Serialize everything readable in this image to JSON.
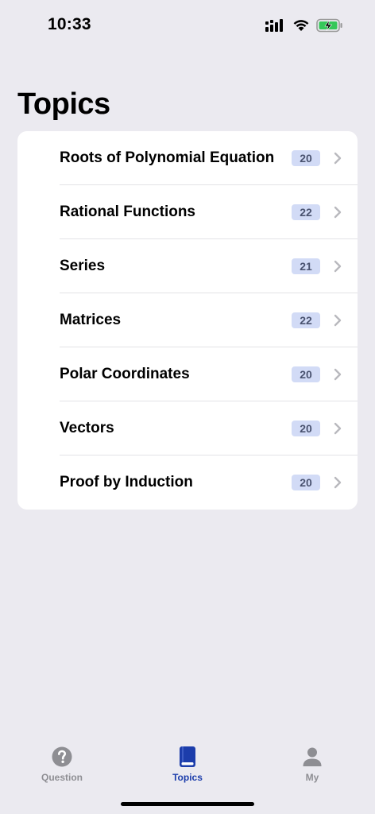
{
  "status_bar": {
    "time": "10:33"
  },
  "page_title": "Topics",
  "topics": [
    {
      "label": "Roots of Polynomial Equation",
      "count": "20"
    },
    {
      "label": "Rational Functions",
      "count": "22"
    },
    {
      "label": "Series",
      "count": "21"
    },
    {
      "label": "Matrices",
      "count": "22"
    },
    {
      "label": "Polar Coordinates",
      "count": "20"
    },
    {
      "label": "Vectors",
      "count": "20"
    },
    {
      "label": "Proof by Induction",
      "count": "20"
    }
  ],
  "tab_bar": {
    "tabs": [
      {
        "label": "Question",
        "icon": "question-circle-icon",
        "active": false
      },
      {
        "label": "Topics",
        "icon": "book-icon",
        "active": true
      },
      {
        "label": "My",
        "icon": "person-icon",
        "active": false
      }
    ]
  },
  "colors": {
    "background": "#ebeaf0",
    "badge_bg": "#d2dbf6",
    "badge_text": "#4a5370",
    "active_tab": "#1c3dab",
    "inactive_tab": "#8e8e93",
    "battery_fill": "#35c759"
  }
}
